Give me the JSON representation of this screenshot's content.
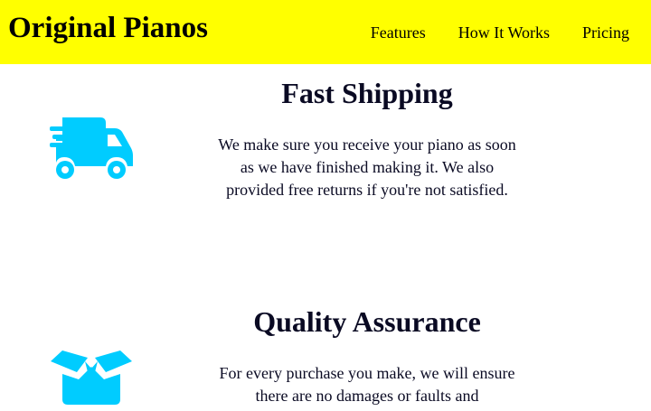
{
  "header": {
    "logo": "Original Pianos",
    "nav": [
      {
        "label": "Features"
      },
      {
        "label": "How It Works"
      },
      {
        "label": "Pricing"
      }
    ],
    "background_color": "#ffff00"
  },
  "features": [
    {
      "title": "Fast Shipping",
      "text": "We make sure you receive your piano as soon as we have finished making it. We also provided free returns if you're not satisfied.",
      "icon": "truck-icon",
      "icon_color": "#00ccff"
    },
    {
      "title": "Quality Assurance",
      "text": "For every purchase you make, we will ensure there are no damages or faults and",
      "icon": "open-box-icon",
      "icon_color": "#00ccff"
    }
  ]
}
